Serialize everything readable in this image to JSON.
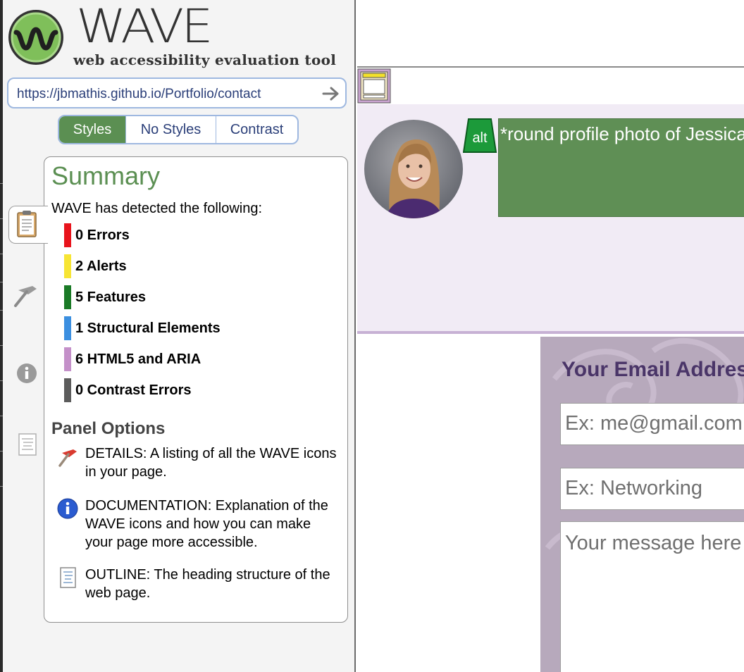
{
  "brand": {
    "title": "WAVE",
    "subtitle": "web accessibility evaluation tool"
  },
  "url_bar": {
    "value": "https://jbmathis.github.io/Portfolio/contact"
  },
  "view_tabs": [
    {
      "label": "Styles",
      "active": true
    },
    {
      "label": "No Styles",
      "active": false
    },
    {
      "label": "Contrast",
      "active": false
    }
  ],
  "summary": {
    "title": "Summary",
    "intro": "WAVE has detected the following:",
    "stats": [
      {
        "label": "0 Errors",
        "color": "#e8141c"
      },
      {
        "label": "2 Alerts",
        "color": "#f7e534"
      },
      {
        "label": "5 Features",
        "color": "#1a7a26"
      },
      {
        "label": "1 Structural Elements",
        "color": "#3b8fe0"
      },
      {
        "label": "6 HTML5 and ARIA",
        "color": "#c490c9"
      },
      {
        "label": "0 Contrast Errors",
        "color": "#5c5c5c"
      }
    ],
    "panel_options_title": "Panel Options",
    "options": [
      {
        "icon": "details-flag-icon",
        "text": "DETAILS: A listing of all the WAVE icons in your page."
      },
      {
        "icon": "info-icon",
        "text": "DOCUMENTATION: Explanation of the WAVE icons and how you can make your page more accessible."
      },
      {
        "icon": "outline-document-icon",
        "text": "OUTLINE: The heading structure of the web page."
      }
    ]
  },
  "side_tabs": [
    "summary-clipboard-icon",
    "details-flag-icon",
    "info-icon",
    "outline-document-icon"
  ],
  "page_preview": {
    "alt_badge": "alt",
    "alt_text": "*round profile photo of Jessica",
    "email_heading": "Your Email Address",
    "email_placeholder": "Ex: me@gmail.com",
    "subject_placeholder": "Ex: Networking",
    "message_placeholder": "Your message here"
  },
  "colors": {
    "accent_green": "#5b8f52",
    "link_blue": "#2b3f79",
    "profile_band": "#f1ebf5",
    "form_background": "#b7a9bc",
    "heading_purple": "#4a3568"
  }
}
